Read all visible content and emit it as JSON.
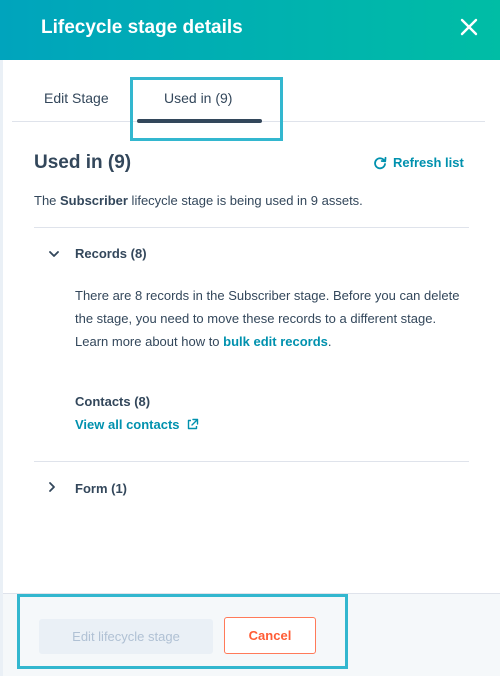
{
  "header": {
    "title": "Lifecycle stage details",
    "close_icon": "close-icon"
  },
  "tabs": [
    {
      "label": "Edit Stage",
      "active": false
    },
    {
      "label": "Used in (9)",
      "active": true
    }
  ],
  "used_in": {
    "title": "Used in (9)",
    "refresh_label": "Refresh list",
    "desc_prefix": "The ",
    "desc_stage": "Subscriber",
    "desc_suffix": " lifecycle stage is being used in 9 assets."
  },
  "records": {
    "heading": "Records (8)",
    "body_text": "There are 8 records in the Subscriber stage. Before you can delete the stage, you need to move these records to a different stage. Learn more about how to ",
    "body_link": "bulk edit records",
    "body_end": ".",
    "contacts_label": "Contacts (8)",
    "contacts_link": "View all contacts"
  },
  "form": {
    "heading": "Form (1)"
  },
  "footer": {
    "edit_button": "Edit lifecycle stage",
    "cancel_button": "Cancel"
  },
  "colors": {
    "header_gradient_start": "#00a4bd",
    "header_gradient_end": "#00bda5",
    "link": "#0091ae",
    "cancel": "#ff5c35",
    "highlight": "#33b7cf"
  }
}
